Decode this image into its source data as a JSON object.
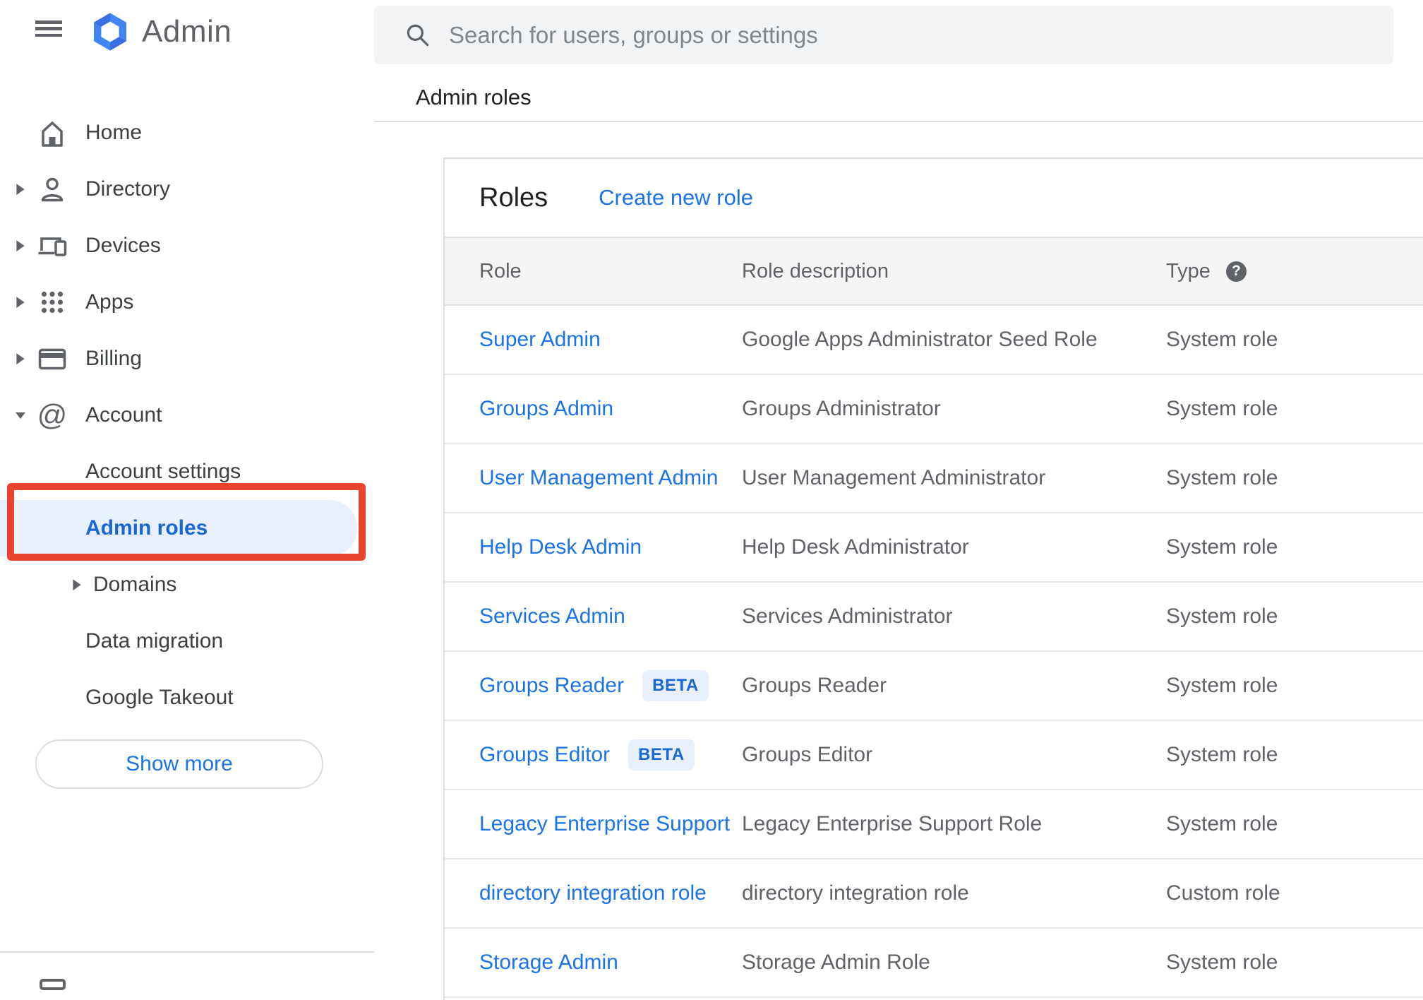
{
  "app": {
    "brand": "Admin"
  },
  "search": {
    "placeholder": "Search for users, groups or settings"
  },
  "breadcrumb": "Admin roles",
  "sidebar": {
    "items": [
      {
        "label": "Home",
        "icon": "home",
        "level": 0,
        "expandable": false
      },
      {
        "label": "Directory",
        "icon": "person",
        "level": 0,
        "expandable": true
      },
      {
        "label": "Devices",
        "icon": "devices",
        "level": 0,
        "expandable": true
      },
      {
        "label": "Apps",
        "icon": "apps-grid",
        "level": 0,
        "expandable": true
      },
      {
        "label": "Billing",
        "icon": "credit-card",
        "level": 0,
        "expandable": true
      },
      {
        "label": "Account",
        "icon": "at-sign",
        "level": 0,
        "expandable": true,
        "expanded": true
      },
      {
        "label": "Account settings",
        "level": 1
      },
      {
        "label": "Admin roles",
        "level": 1,
        "active": true,
        "annotated": true
      },
      {
        "label": "Domains",
        "level": 1,
        "expandable": true
      },
      {
        "label": "Data migration",
        "level": 1
      },
      {
        "label": "Google Takeout",
        "level": 1
      }
    ],
    "show_more_label": "Show more"
  },
  "roles_panel": {
    "title": "Roles",
    "create_link": "Create new role",
    "columns": [
      "Role",
      "Role description",
      "Type"
    ],
    "help_glyph": "?",
    "beta_label": "BETA",
    "rows": [
      {
        "role": "Super Admin",
        "beta": false,
        "description": "Google Apps Administrator Seed Role",
        "type": "System role"
      },
      {
        "role": "Groups Admin",
        "beta": false,
        "description": "Groups Administrator",
        "type": "System role"
      },
      {
        "role": "User Management Admin",
        "beta": false,
        "description": "User Management Administrator",
        "type": "System role"
      },
      {
        "role": "Help Desk Admin",
        "beta": false,
        "description": "Help Desk Administrator",
        "type": "System role"
      },
      {
        "role": "Services Admin",
        "beta": false,
        "description": "Services Administrator",
        "type": "System role"
      },
      {
        "role": "Groups Reader",
        "beta": true,
        "description": "Groups Reader",
        "type": "System role"
      },
      {
        "role": "Groups Editor",
        "beta": true,
        "description": "Groups Editor",
        "type": "System role"
      },
      {
        "role": "Legacy Enterprise Support",
        "beta": false,
        "description": "Legacy Enterprise Support Role",
        "type": "System role"
      },
      {
        "role": "directory integration role",
        "beta": false,
        "description": "directory integration role",
        "type": "Custom role"
      },
      {
        "role": "Storage Admin",
        "beta": false,
        "description": "Storage Admin Role",
        "type": "System role"
      }
    ]
  },
  "colors": {
    "accent_blue": "#1a73e8",
    "active_blue": "#1967d2",
    "active_bg": "#e8f0fe",
    "annotation_red": "#e8432c",
    "icon_gray": "#5f6368"
  }
}
